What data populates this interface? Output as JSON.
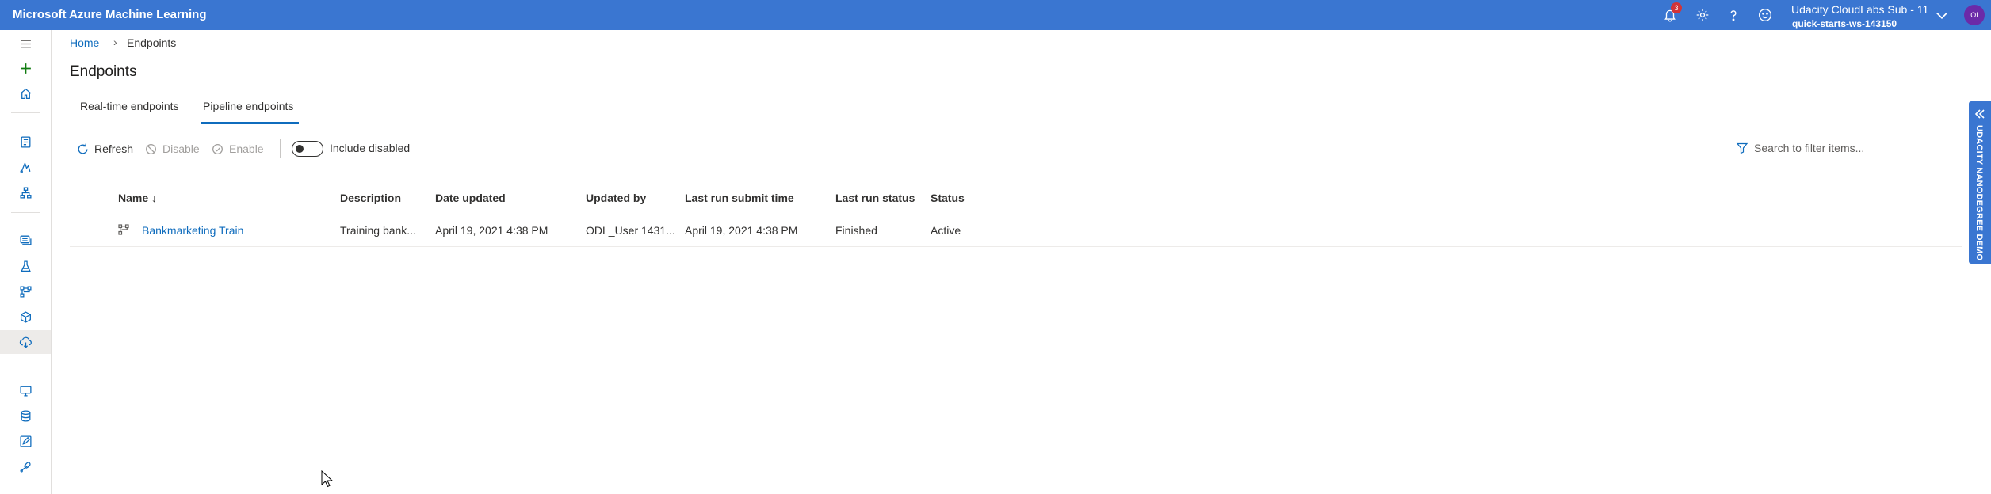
{
  "topbar": {
    "brand": "Microsoft Azure Machine Learning",
    "notification_count": "3",
    "account_name": "Udacity CloudLabs Sub - 11",
    "workspace": "quick-starts-ws-143150",
    "avatar_initials": "OI",
    "accent_color": "#3a76d1"
  },
  "breadcrumb": {
    "home": "Home",
    "current": "Endpoints"
  },
  "page": {
    "title": "Endpoints"
  },
  "tabs": [
    {
      "label": "Real-time endpoints",
      "selected": false
    },
    {
      "label": "Pipeline endpoints",
      "selected": true
    }
  ],
  "toolbar": {
    "refresh": "Refresh",
    "disable": "Disable",
    "enable": "Enable",
    "include_disabled": "Include disabled",
    "search_placeholder": "Search to filter items..."
  },
  "table": {
    "columns": [
      "Name",
      "Description",
      "Date updated",
      "Updated by",
      "Last run submit time",
      "Last run status",
      "Status"
    ],
    "sort_indicator": "↓",
    "rows": [
      {
        "name": "Bankmarketing Train",
        "description": "Training bank...",
        "date_updated": "April 19, 2021 4:38 PM",
        "updated_by": "ODL_User 1431...",
        "last_run_submit_time": "April 19, 2021 4:38 PM",
        "last_run_status": "Finished",
        "status": "Active"
      }
    ]
  },
  "ribbon": {
    "label": "UDACITY NANODEGREE DEMO"
  }
}
